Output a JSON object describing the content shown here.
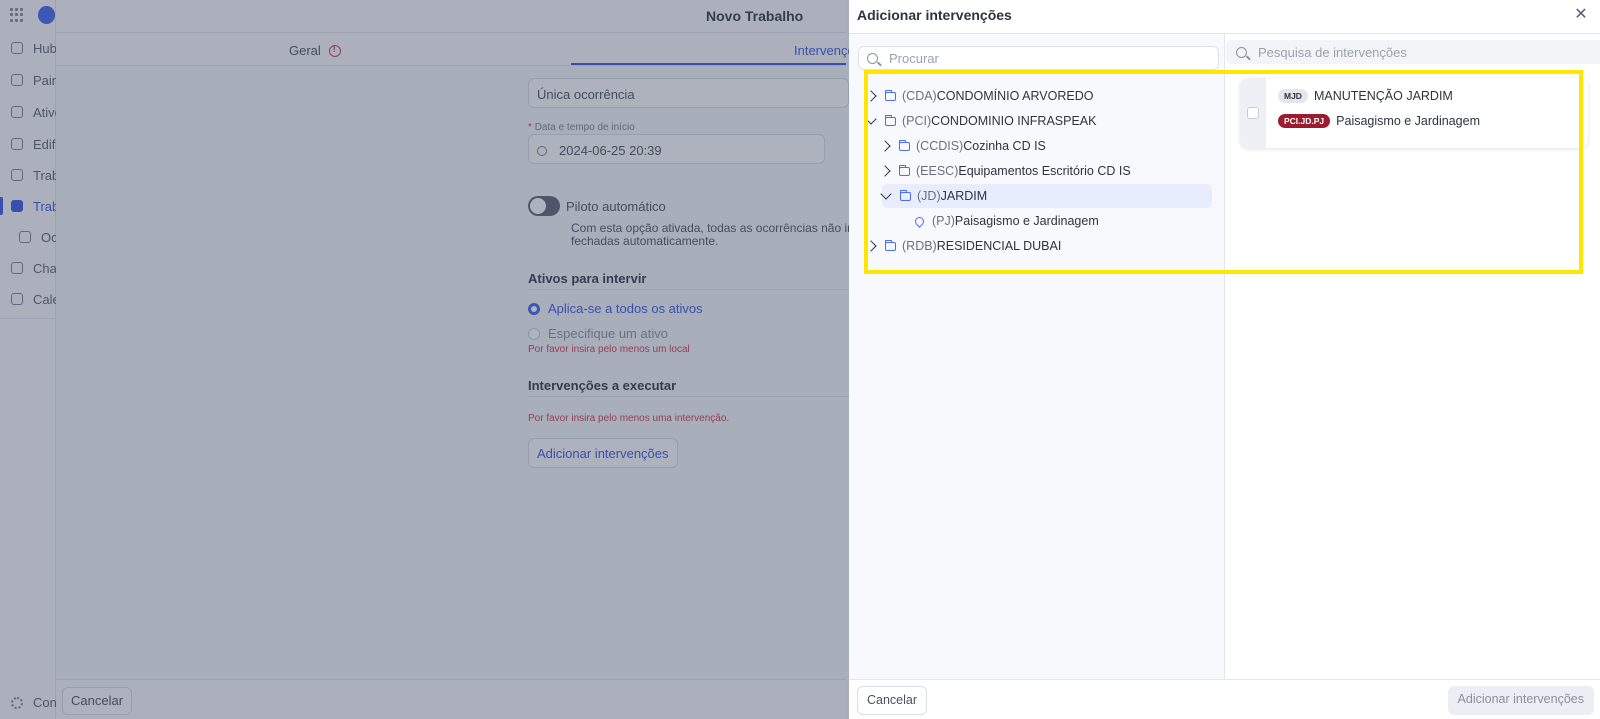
{
  "background": {
    "page_title": "Novo Trabalho",
    "tabs": [
      {
        "label": "Geral"
      },
      {
        "label": "Intervençõ"
      }
    ],
    "sidebar": {
      "items": [
        {
          "label": "Hub"
        },
        {
          "label": "Paine"
        },
        {
          "label": "Ativo"
        },
        {
          "label": "Edifí"
        },
        {
          "label": "Trab"
        },
        {
          "label": "Trab"
        },
        {
          "label": "Oc"
        },
        {
          "label": "Cha"
        },
        {
          "label": "Cale"
        }
      ],
      "config_label": "Con"
    },
    "form": {
      "occurrence_value": "Única ocorrência",
      "date_label_required": "*",
      "date_label": "Data e tempo de início",
      "date_value": "2024-06-25 20:39",
      "autopilot_label": "Piloto automático",
      "autopilot_desc_line1": "Com esta opção ativada, todas as ocorrências não inic",
      "autopilot_desc_line2": "fechadas automaticamente.",
      "assets_heading": "Ativos para intervir",
      "assets_option_all": "Aplica-se a todos os ativos",
      "assets_option_specific": "Especifique um ativo",
      "assets_error": "Por favor insira pelo menos um local",
      "interventions_heading": "Intervenções a executar",
      "interventions_error": "Por favor insira pelo menos uma intervenção.",
      "add_interventions_button": "Adicionar intervenções"
    },
    "cancel_button": "Cancelar"
  },
  "drawer": {
    "title": "Adicionar intervenções",
    "close_icon": "close-icon",
    "left_search": {
      "placeholder": "Procurar"
    },
    "right_search": {
      "placeholder": "Pesquisa de intervenções"
    },
    "tree": [
      {
        "code": "(CDA)",
        "name": "CONDOMÍNIO ARVOREDO",
        "expanded": false
      },
      {
        "code": "(PCI)",
        "name": "CONDOMINIO INFRASPEAK",
        "expanded": true
      },
      {
        "code": "(CCDIS)",
        "name": "Cozinha CD IS",
        "expanded": false
      },
      {
        "code": "(EESC)",
        "name": "Equipamentos Escritório CD IS",
        "expanded": false
      },
      {
        "code": "(JD)",
        "name": "JARDIM",
        "expanded": true,
        "selected": true
      },
      {
        "code": "(PJ)",
        "name": "Paisagismo e Jardinagem",
        "type": "location"
      },
      {
        "code": "(RDB)",
        "name": "RESIDENCIAL DUBAI",
        "expanded": false
      }
    ],
    "results": [
      {
        "badge1": "MJD",
        "title": "MANUTENÇÃO JARDIM",
        "badge2": "PCI.JD.PJ",
        "location": "Paisagismo e Jardinagem"
      }
    ],
    "footer": {
      "cancel_button": "Cancelar",
      "add_button": "Adicionar intervenções"
    }
  },
  "colors": {
    "accent": "#3455e6",
    "error": "#d23a4b",
    "badge_red": "#9b1c2e",
    "highlight": "#ffe500"
  }
}
